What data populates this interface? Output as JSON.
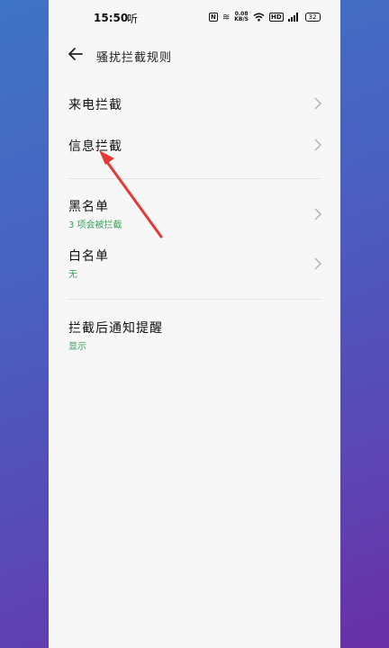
{
  "status_bar": {
    "time": "15:50",
    "carrier_text": "听",
    "network_speed_value": "0.08",
    "network_speed_unit": "KB/S",
    "hd_badge": "HD",
    "battery_level": "32"
  },
  "header": {
    "title": "骚扰拦截规则"
  },
  "section1": {
    "call_block_label": "来电拦截",
    "message_block_label": "信息拦截"
  },
  "section2": {
    "blacklist_label": "黑名单",
    "blacklist_sub": "3 项会被拦截",
    "whitelist_label": "白名单",
    "whitelist_sub": "无"
  },
  "section3": {
    "notify_label": "拦截后通知提醒",
    "notify_sub": "显示"
  },
  "colors": {
    "accent_green": "#3aa35a",
    "annotation_arrow": "#e53935"
  }
}
